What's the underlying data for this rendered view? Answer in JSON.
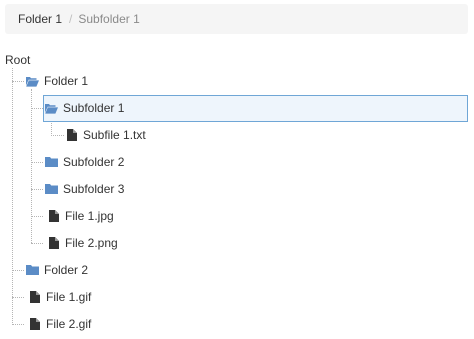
{
  "breadcrumb": {
    "items": [
      "Folder 1",
      "Subfolder 1"
    ],
    "separator": "/"
  },
  "tree": {
    "root_label": "Root",
    "nodes": [
      {
        "label": "Folder 1",
        "type": "folder-open"
      },
      {
        "label": "Subfolder 1",
        "type": "folder-open",
        "selected": true
      },
      {
        "label": "Subfile 1.txt",
        "type": "file"
      },
      {
        "label": "Subfolder 2",
        "type": "folder"
      },
      {
        "label": "Subfolder 3",
        "type": "folder"
      },
      {
        "label": "File 1.jpg",
        "type": "file"
      },
      {
        "label": "File 2.png",
        "type": "file"
      },
      {
        "label": "Folder 2",
        "type": "folder"
      },
      {
        "label": "File 1.gif",
        "type": "file"
      },
      {
        "label": "File 2.gif",
        "type": "file"
      }
    ]
  },
  "colors": {
    "folder": "#5b8cc6",
    "file": "#333333",
    "selected_border": "#6fa6d6",
    "selected_bg": "#eef5fc"
  }
}
